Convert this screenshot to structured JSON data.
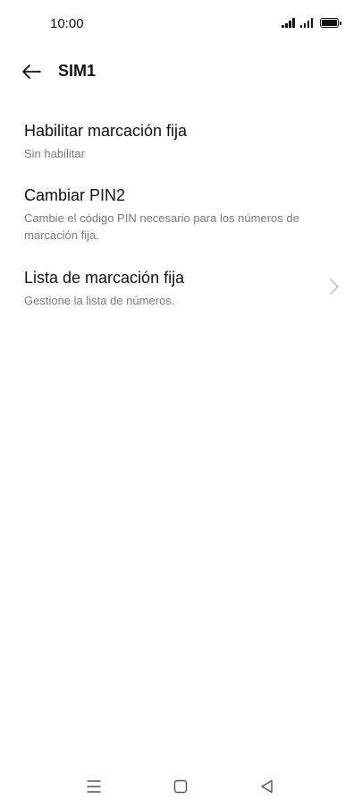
{
  "status_bar": {
    "time": "10:00",
    "icons": [
      "signal-sim1-icon",
      "signal-sim2-icon",
      "battery-icon"
    ]
  },
  "header": {
    "title": "SIM1",
    "back_icon": "back-arrow-icon"
  },
  "items": [
    {
      "title": "Habilitar marcación fija",
      "subtitle": "Sin habilitar"
    },
    {
      "title": "Cambiar PIN2",
      "subtitle": "Cambie el código PIN necesario para los números de marcación fija."
    },
    {
      "title": "Lista de marcación fija",
      "subtitle": "Gestione la lista de números.",
      "icon": "chevron-right-icon"
    }
  ],
  "nav_bar": {
    "icons": [
      "menu-icon",
      "home-icon",
      "back-icon"
    ]
  },
  "colors": {
    "background": "#ffffff",
    "text_primary": "#111111",
    "text_secondary": "#7a7a7a",
    "chevron": "#b8b8b8"
  }
}
